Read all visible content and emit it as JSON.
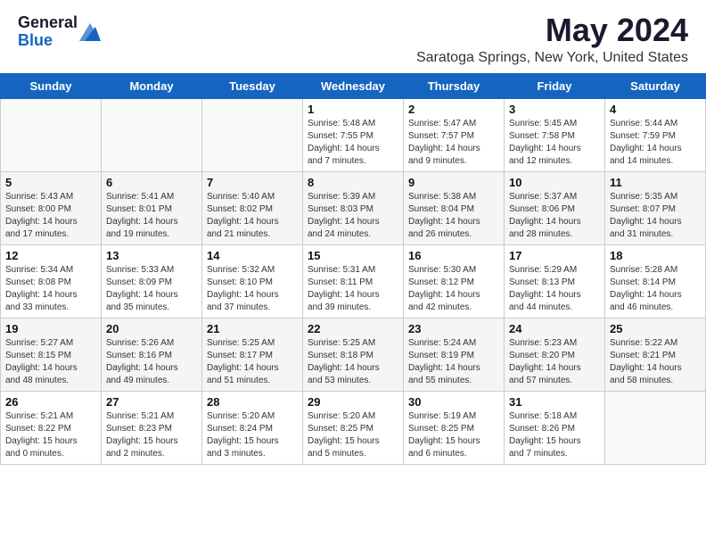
{
  "header": {
    "logo_general": "General",
    "logo_blue": "Blue",
    "month_year": "May 2024",
    "location": "Saratoga Springs, New York, United States"
  },
  "weekdays": [
    "Sunday",
    "Monday",
    "Tuesday",
    "Wednesday",
    "Thursday",
    "Friday",
    "Saturday"
  ],
  "weeks": [
    [
      {
        "day": "",
        "info": ""
      },
      {
        "day": "",
        "info": ""
      },
      {
        "day": "",
        "info": ""
      },
      {
        "day": "1",
        "info": "Sunrise: 5:48 AM\nSunset: 7:55 PM\nDaylight: 14 hours\nand 7 minutes."
      },
      {
        "day": "2",
        "info": "Sunrise: 5:47 AM\nSunset: 7:57 PM\nDaylight: 14 hours\nand 9 minutes."
      },
      {
        "day": "3",
        "info": "Sunrise: 5:45 AM\nSunset: 7:58 PM\nDaylight: 14 hours\nand 12 minutes."
      },
      {
        "day": "4",
        "info": "Sunrise: 5:44 AM\nSunset: 7:59 PM\nDaylight: 14 hours\nand 14 minutes."
      }
    ],
    [
      {
        "day": "5",
        "info": "Sunrise: 5:43 AM\nSunset: 8:00 PM\nDaylight: 14 hours\nand 17 minutes."
      },
      {
        "day": "6",
        "info": "Sunrise: 5:41 AM\nSunset: 8:01 PM\nDaylight: 14 hours\nand 19 minutes."
      },
      {
        "day": "7",
        "info": "Sunrise: 5:40 AM\nSunset: 8:02 PM\nDaylight: 14 hours\nand 21 minutes."
      },
      {
        "day": "8",
        "info": "Sunrise: 5:39 AM\nSunset: 8:03 PM\nDaylight: 14 hours\nand 24 minutes."
      },
      {
        "day": "9",
        "info": "Sunrise: 5:38 AM\nSunset: 8:04 PM\nDaylight: 14 hours\nand 26 minutes."
      },
      {
        "day": "10",
        "info": "Sunrise: 5:37 AM\nSunset: 8:06 PM\nDaylight: 14 hours\nand 28 minutes."
      },
      {
        "day": "11",
        "info": "Sunrise: 5:35 AM\nSunset: 8:07 PM\nDaylight: 14 hours\nand 31 minutes."
      }
    ],
    [
      {
        "day": "12",
        "info": "Sunrise: 5:34 AM\nSunset: 8:08 PM\nDaylight: 14 hours\nand 33 minutes."
      },
      {
        "day": "13",
        "info": "Sunrise: 5:33 AM\nSunset: 8:09 PM\nDaylight: 14 hours\nand 35 minutes."
      },
      {
        "day": "14",
        "info": "Sunrise: 5:32 AM\nSunset: 8:10 PM\nDaylight: 14 hours\nand 37 minutes."
      },
      {
        "day": "15",
        "info": "Sunrise: 5:31 AM\nSunset: 8:11 PM\nDaylight: 14 hours\nand 39 minutes."
      },
      {
        "day": "16",
        "info": "Sunrise: 5:30 AM\nSunset: 8:12 PM\nDaylight: 14 hours\nand 42 minutes."
      },
      {
        "day": "17",
        "info": "Sunrise: 5:29 AM\nSunset: 8:13 PM\nDaylight: 14 hours\nand 44 minutes."
      },
      {
        "day": "18",
        "info": "Sunrise: 5:28 AM\nSunset: 8:14 PM\nDaylight: 14 hours\nand 46 minutes."
      }
    ],
    [
      {
        "day": "19",
        "info": "Sunrise: 5:27 AM\nSunset: 8:15 PM\nDaylight: 14 hours\nand 48 minutes."
      },
      {
        "day": "20",
        "info": "Sunrise: 5:26 AM\nSunset: 8:16 PM\nDaylight: 14 hours\nand 49 minutes."
      },
      {
        "day": "21",
        "info": "Sunrise: 5:25 AM\nSunset: 8:17 PM\nDaylight: 14 hours\nand 51 minutes."
      },
      {
        "day": "22",
        "info": "Sunrise: 5:25 AM\nSunset: 8:18 PM\nDaylight: 14 hours\nand 53 minutes."
      },
      {
        "day": "23",
        "info": "Sunrise: 5:24 AM\nSunset: 8:19 PM\nDaylight: 14 hours\nand 55 minutes."
      },
      {
        "day": "24",
        "info": "Sunrise: 5:23 AM\nSunset: 8:20 PM\nDaylight: 14 hours\nand 57 minutes."
      },
      {
        "day": "25",
        "info": "Sunrise: 5:22 AM\nSunset: 8:21 PM\nDaylight: 14 hours\nand 58 minutes."
      }
    ],
    [
      {
        "day": "26",
        "info": "Sunrise: 5:21 AM\nSunset: 8:22 PM\nDaylight: 15 hours\nand 0 minutes."
      },
      {
        "day": "27",
        "info": "Sunrise: 5:21 AM\nSunset: 8:23 PM\nDaylight: 15 hours\nand 2 minutes."
      },
      {
        "day": "28",
        "info": "Sunrise: 5:20 AM\nSunset: 8:24 PM\nDaylight: 15 hours\nand 3 minutes."
      },
      {
        "day": "29",
        "info": "Sunrise: 5:20 AM\nSunset: 8:25 PM\nDaylight: 15 hours\nand 5 minutes."
      },
      {
        "day": "30",
        "info": "Sunrise: 5:19 AM\nSunset: 8:25 PM\nDaylight: 15 hours\nand 6 minutes."
      },
      {
        "day": "31",
        "info": "Sunrise: 5:18 AM\nSunset: 8:26 PM\nDaylight: 15 hours\nand 7 minutes."
      },
      {
        "day": "",
        "info": ""
      }
    ]
  ]
}
